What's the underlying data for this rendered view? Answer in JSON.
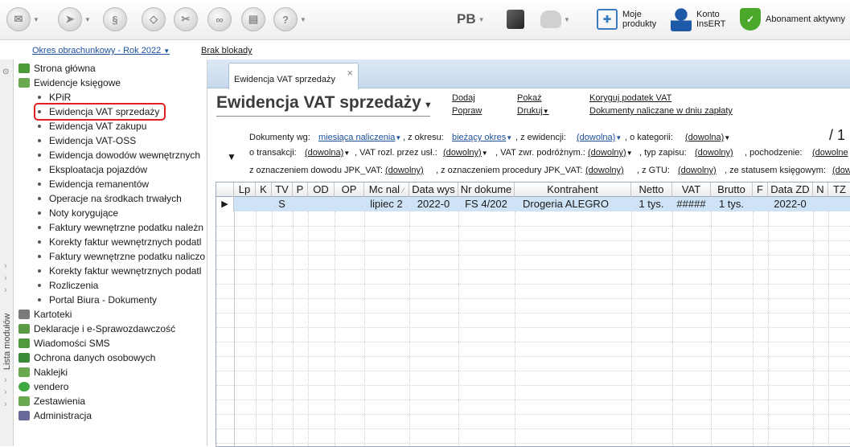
{
  "toolbar": {
    "pb_label": "PB",
    "moje_produkty": [
      "Moje",
      "produkty"
    ],
    "konto_insert": [
      "Konto",
      "InsERT"
    ],
    "abonament": "Abonament aktywny"
  },
  "subbar": {
    "okres": "Okres obrachunkowy - Rok 2022",
    "blokada": "Brak blokady"
  },
  "sidebar": {
    "vertical_label": "Lista modułów",
    "top_items": [
      "Strona główna",
      "Ewidencje księgowe"
    ],
    "sub_items": [
      "KPiR",
      "Ewidencja VAT sprzedaży",
      "Ewidencja VAT zakupu",
      "Ewidencja VAT-OSS",
      "Ewidencja dowodów wewnętrznych",
      "Eksploatacja pojazdów",
      "Ewidencja remanentów",
      "Operacje na środkach trwałych",
      "Noty korygujące",
      "Faktury wewnętrzne podatku należn",
      "Korekty faktur wewnętrznych podatl",
      "Faktury wewnętrzne podatku naliczo",
      "Korekty faktur wewnętrznych podatl",
      "Rozliczenia",
      "Portal Biura - Dokumenty"
    ],
    "bottom_items": [
      "Kartoteki",
      "Deklaracje i e-Sprawozdawczość",
      "Wiadomości SMS",
      "Ochrona danych osobowych",
      "Naklejki",
      "vendero",
      "Zestawienia",
      "Administracja"
    ],
    "selected": "Ewidencja VAT sprzedaży"
  },
  "tab": {
    "label": "Ewidencja VAT sprzedaży",
    "close": "×"
  },
  "page": {
    "title": "Ewidencja VAT sprzedaży",
    "counter": "/ 1",
    "actions": {
      "dodaj": "Dodaj",
      "popraw": "Popraw",
      "pokaz": "Pokaż",
      "drukuj": "Drukuj",
      "koryguj": "Koryguj podatek VAT",
      "dokumenty": "Dokumenty naliczane w dniu zapłaty"
    }
  },
  "filters": {
    "row1": {
      "l1": "Dokumenty wg:",
      "v1": "miesiąca naliczenia",
      "l2": ", z okresu:",
      "v2": "bieżący okres",
      "l3": ", z ewidencji:",
      "v3": "(dowolna)",
      "l4": ", o kategorii:",
      "v4": "(dowolna)"
    },
    "row2": {
      "l1": "o transakcji:",
      "v1": "(dowolna)",
      "l2": ", VAT rozl. przez usł.:",
      "v2": "(dowolny)",
      "l3": ", VAT zwr. podróżnym.:",
      "v3": "(dowolny)",
      "l4": ", typ zapisu:",
      "v4": "(dowolny)",
      "l5": ", pochodzenie:",
      "v5": "(dowolne"
    },
    "row3": {
      "l1": "z oznaczeniem dowodu JPK_VAT:",
      "v1": "(dowolny)",
      "l2": ", z oznaczeniem procedury JPK_VAT:",
      "v2": "(dowolny)",
      "l3": ", z GTU:",
      "v3": "(dowolny)",
      "l4": ", ze statusem księgowym:",
      "v4": "(dow"
    }
  },
  "table": {
    "columns": [
      "",
      "Lp",
      "K",
      "TV",
      "P",
      "OD",
      "OP",
      "Mc nal",
      "Data wys",
      "Nr dokume",
      "Kontrahent",
      "Netto",
      "VAT",
      "Brutto",
      "F",
      "Data ZD",
      "N",
      "TZ"
    ],
    "sort_marker": "⁄",
    "row": [
      "▶",
      "",
      "",
      "S",
      "",
      "",
      "",
      "lipiec 2",
      "2022-0",
      "FS 4/202",
      "Drogeria ALEGRO",
      "1 tys.",
      "#####",
      "1 tys.",
      "",
      "2022-0",
      "",
      ""
    ]
  },
  "colors": {
    "accent": "#1c4f9c",
    "selected_row": "#cfe3f7",
    "highlight": "#e02020"
  }
}
